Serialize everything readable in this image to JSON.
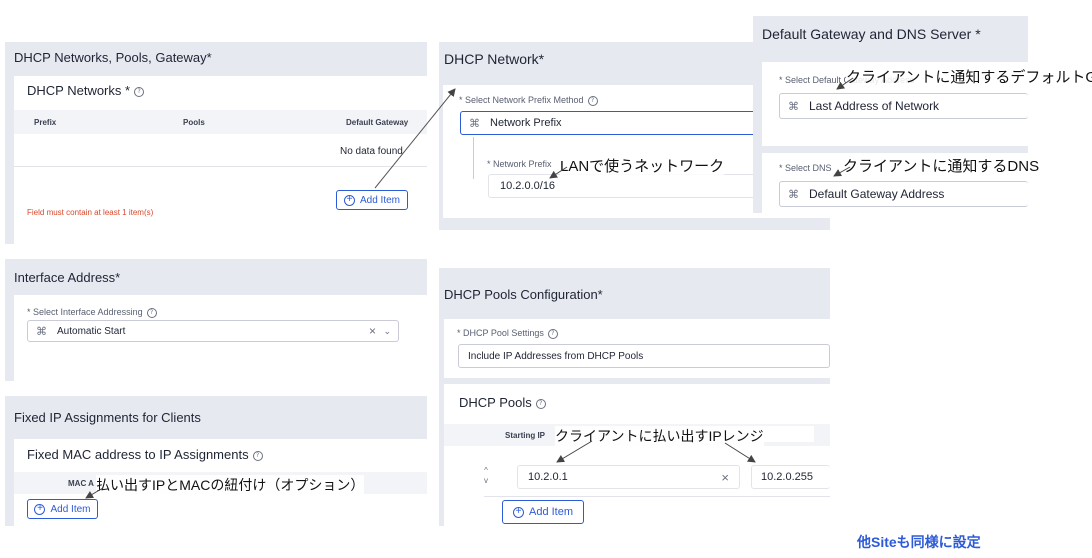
{
  "left": {
    "networks_panel": {
      "title": "DHCP Networks, Pools, Gateway",
      "card_title": "DHCP Networks",
      "columns": [
        "Prefix",
        "Pools",
        "Default Gateway"
      ],
      "empty_text": "No data found",
      "add_label": "Add Item",
      "error_text": "Field must contain at least 1 item(s)"
    },
    "interface_panel": {
      "title": "Interface Address",
      "field_label": "Select Interface Addressing",
      "field_value": "Automatic Start"
    },
    "fixed_panel": {
      "title": "Fixed IP Assignments for Clients",
      "card_title": "Fixed MAC address to IP Assignments",
      "column": "MAC A",
      "add_label": "Add Item"
    }
  },
  "middle": {
    "network_panel": {
      "title": "DHCP Network",
      "method_label": "Select Network Prefix Method",
      "method_value": "Network Prefix",
      "prefix_label": "Network Prefix",
      "prefix_value": "10.2.0.0/16"
    },
    "pools_panel": {
      "title": "DHCP Pools Configuration",
      "settings_label": "DHCP Pool Settings",
      "settings_value": "Include IP Addresses from DHCP Pools",
      "pools_title": "DHCP Pools",
      "column": "Starting IP",
      "start_ip": "10.2.0.1",
      "end_ip": "10.2.0.255",
      "add_label": "Add Item"
    }
  },
  "right": {
    "gateway_panel": {
      "title": "Default Gateway and DNS Server",
      "gw_label": "Select Default Gateway Address",
      "gw_value": "Last Address of Network",
      "dns_label": "Select DNS",
      "dns_value": "Default Gateway Address"
    }
  },
  "annotations": {
    "gateway": "クライアントに通知するデフォルトGW",
    "dns": "クライアントに通知するDNS",
    "lan": "LANで使うネットワーク",
    "pool_range": "クライアントに払い出すIPレンジ",
    "fixed": "払い出すIPとMACの紐付け（オプション）",
    "footer": "他Siteも同様に設定"
  },
  "colors": {
    "accent": "#2d5bd7",
    "panel": "#e7e9f1",
    "error": "#d9482b",
    "footer": "#2d5bd7"
  },
  "icons": [
    "network-icon",
    "info-icon",
    "add-circle-icon",
    "clear-icon",
    "chevron-down-icon",
    "sort-arrows-icon"
  ]
}
